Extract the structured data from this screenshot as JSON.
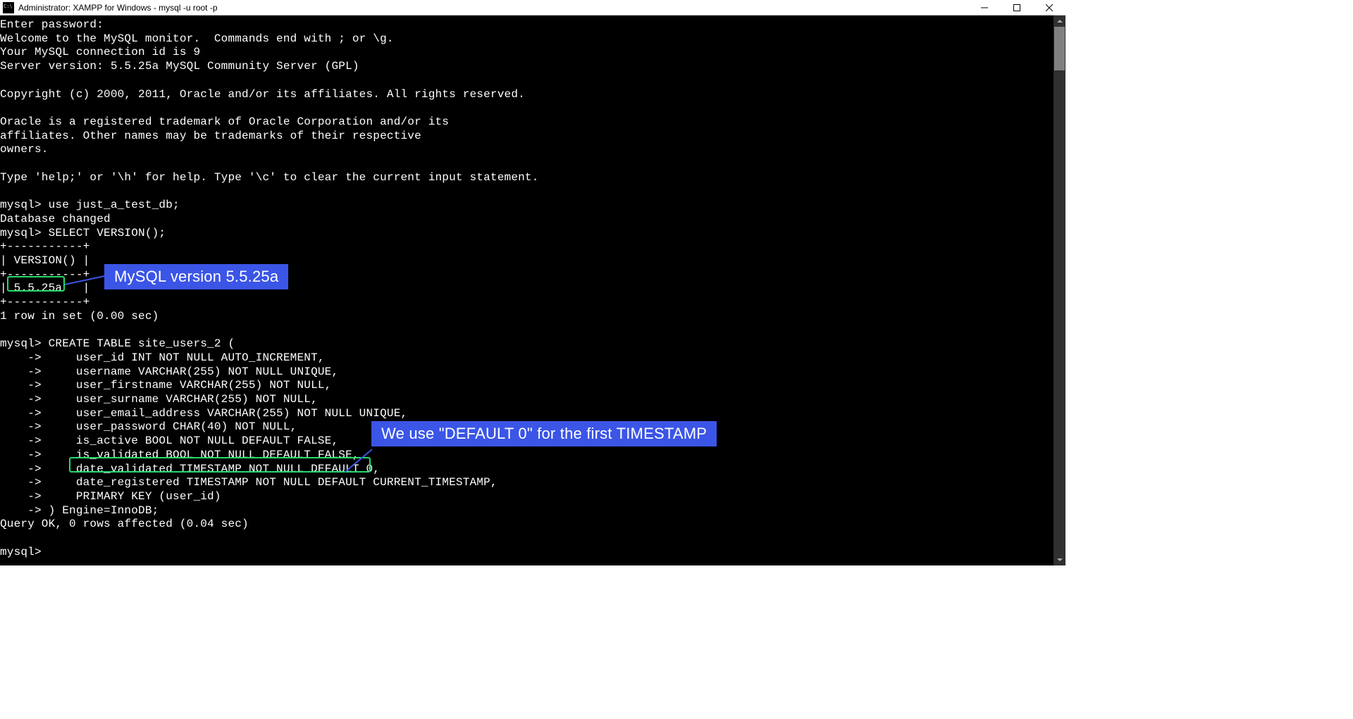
{
  "titlebar": {
    "title": "Administrator:  XAMPP for Windows - mysql  -u root -p"
  },
  "terminal": {
    "lines": [
      "Enter password:",
      "Welcome to the MySQL monitor.  Commands end with ; or \\g.",
      "Your MySQL connection id is 9",
      "Server version: 5.5.25a MySQL Community Server (GPL)",
      "",
      "Copyright (c) 2000, 2011, Oracle and/or its affiliates. All rights reserved.",
      "",
      "Oracle is a registered trademark of Oracle Corporation and/or its",
      "affiliates. Other names may be trademarks of their respective",
      "owners.",
      "",
      "Type 'help;' or '\\h' for help. Type '\\c' to clear the current input statement.",
      "",
      "mysql> use just_a_test_db;",
      "Database changed",
      "mysql> SELECT VERSION();",
      "+-----------+",
      "| VERSION() |",
      "+-----------+",
      "| 5.5.25a   |",
      "+-----------+",
      "1 row in set (0.00 sec)",
      "",
      "mysql> CREATE TABLE site_users_2 (",
      "    ->     user_id INT NOT NULL AUTO_INCREMENT,",
      "    ->     username VARCHAR(255) NOT NULL UNIQUE,",
      "    ->     user_firstname VARCHAR(255) NOT NULL,",
      "    ->     user_surname VARCHAR(255) NOT NULL,",
      "    ->     user_email_address VARCHAR(255) NOT NULL UNIQUE,",
      "    ->     user_password CHAR(40) NOT NULL,",
      "    ->     is_active BOOL NOT NULL DEFAULT FALSE,",
      "    ->     is_validated BOOL NOT NULL DEFAULT FALSE,",
      "    ->     date_validated TIMESTAMP NOT NULL DEFAULT 0,",
      "    ->     date_registered TIMESTAMP NOT NULL DEFAULT CURRENT_TIMESTAMP,",
      "    ->     PRIMARY KEY (user_id)",
      "    -> ) Engine=InnoDB;",
      "Query OK, 0 rows affected (0.04 sec)",
      "",
      "mysql>"
    ]
  },
  "annotations": {
    "callout1": "MySQL version 5.5.25a",
    "callout2": "We use \"DEFAULT 0\" for the first TIMESTAMP"
  }
}
